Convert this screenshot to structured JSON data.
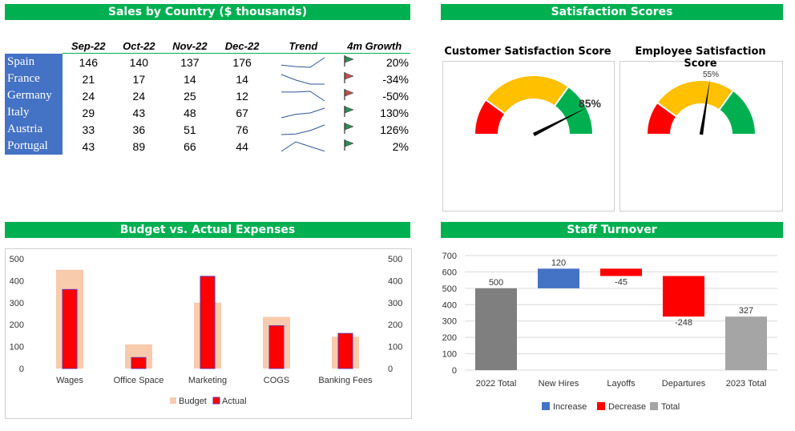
{
  "banners": {
    "sales": "Sales by Country ($ thousands)",
    "satisfaction": "Satisfaction Scores",
    "budget": "Budget vs. Actual Expenses",
    "turnover": "Staff Turnover"
  },
  "sales": {
    "headers": [
      "Sep-22",
      "Oct-22",
      "Nov-22",
      "Dec-22",
      "Trend",
      "4m Growth"
    ],
    "rows": [
      {
        "country": "Spain",
        "values": [
          146,
          140,
          137,
          176
        ],
        "growth": "20%",
        "flag": "up"
      },
      {
        "country": "France",
        "values": [
          21,
          17,
          14,
          14
        ],
        "growth": "-34%",
        "flag": "down"
      },
      {
        "country": "Germany",
        "values": [
          24,
          24,
          25,
          12
        ],
        "growth": "-50%",
        "flag": "down"
      },
      {
        "country": "Italy",
        "values": [
          29,
          43,
          48,
          67
        ],
        "growth": "130%",
        "flag": "up"
      },
      {
        "country": "Austria",
        "values": [
          33,
          36,
          51,
          76
        ],
        "growth": "126%",
        "flag": "up"
      },
      {
        "country": "Portugal",
        "values": [
          43,
          89,
          66,
          44
        ],
        "growth": "2%",
        "flag": "up"
      }
    ],
    "colors": {
      "up": "#2e8b57",
      "down": "#c0504d",
      "trend": "#2f5597",
      "country_bg": "#4472c4"
    }
  },
  "gauges": [
    {
      "title": "Customer Satisfaction Score",
      "value": 0.85,
      "label": "85%"
    },
    {
      "title": "Employee Satisfaction Score",
      "value": 0.55,
      "label": "55%"
    }
  ],
  "gauge_colors": {
    "red": "#ff0000",
    "yellow": "#ffc000",
    "green": "#00b050"
  },
  "chart_data": [
    {
      "type": "bar",
      "title": "",
      "categories": [
        "Wages",
        "Office Space",
        "Marketing",
        "COGS",
        "Banking Fees"
      ],
      "series": [
        {
          "name": "Budget",
          "values": [
            450,
            110,
            300,
            235,
            145
          ],
          "color": "#f8cbad"
        },
        {
          "name": "Actual",
          "values": [
            360,
            50,
            420,
            195,
            160
          ],
          "color": "#ff0000"
        }
      ],
      "ylim": [
        0,
        500
      ],
      "yticks": [
        0,
        100,
        200,
        300,
        400,
        500
      ],
      "secondary_yticks": [
        0,
        100,
        200,
        300,
        400,
        500
      ],
      "grid": false,
      "legend": "bottom"
    },
    {
      "type": "bar",
      "subtype": "waterfall",
      "title": "",
      "categories": [
        "2022 Total",
        "New Hires",
        "Layoffs",
        "Departures",
        "2023 Total"
      ],
      "values": [
        500,
        120,
        -45,
        -248,
        327
      ],
      "labels": [
        "500",
        "120",
        "-45",
        "-248",
        "327"
      ],
      "kinds": [
        "total",
        "increase",
        "decrease",
        "decrease",
        "total"
      ],
      "legend_entries": [
        {
          "name": "Increase",
          "color": "#4472c4"
        },
        {
          "name": "Decrease",
          "color": "#ff0000"
        },
        {
          "name": "Total",
          "color": "#a5a5a5"
        }
      ],
      "total_colors": [
        "#7f7f7f",
        "#a5a5a5"
      ],
      "ylim": [
        0,
        700
      ],
      "yticks": [
        0,
        100,
        200,
        300,
        400,
        500,
        600,
        700
      ],
      "grid": true,
      "legend": "bottom"
    }
  ]
}
